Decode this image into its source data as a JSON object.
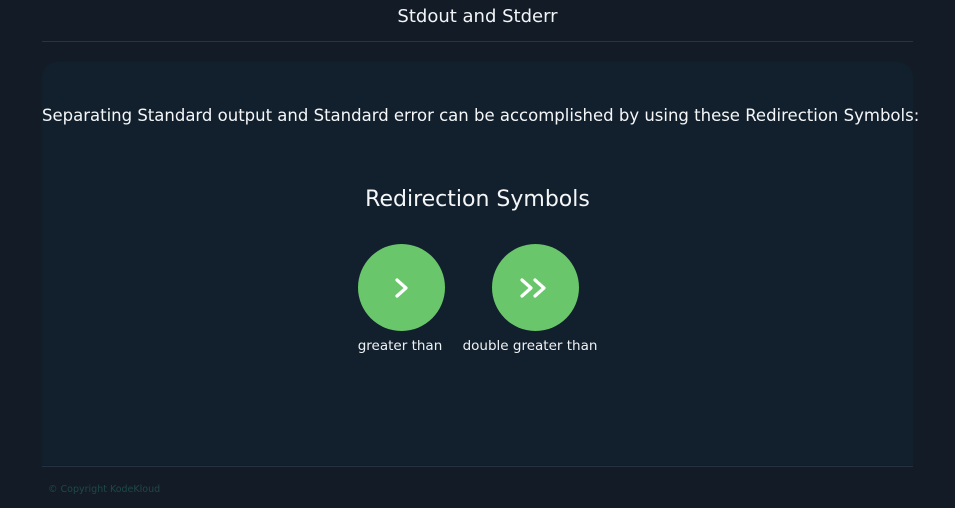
{
  "page": {
    "title": "Stdout and Stderr"
  },
  "intro": {
    "text": "Separating Standard output and Standard error can be accomplished by using these Redirection Symbols:"
  },
  "section": {
    "heading": "Redirection Symbols",
    "symbols": [
      {
        "icon": "greater-than-icon",
        "caption": "greater than"
      },
      {
        "icon": "double-greater-than-icon",
        "caption": "double greater than"
      }
    ]
  },
  "footer": {
    "copyright": "© Copyright KodeKloud"
  },
  "colors": {
    "background": "#131b27",
    "panel": "#12202d",
    "accent_green": "#69c66a",
    "text": "#f4f6f8",
    "footer_text": "#1f4848"
  }
}
